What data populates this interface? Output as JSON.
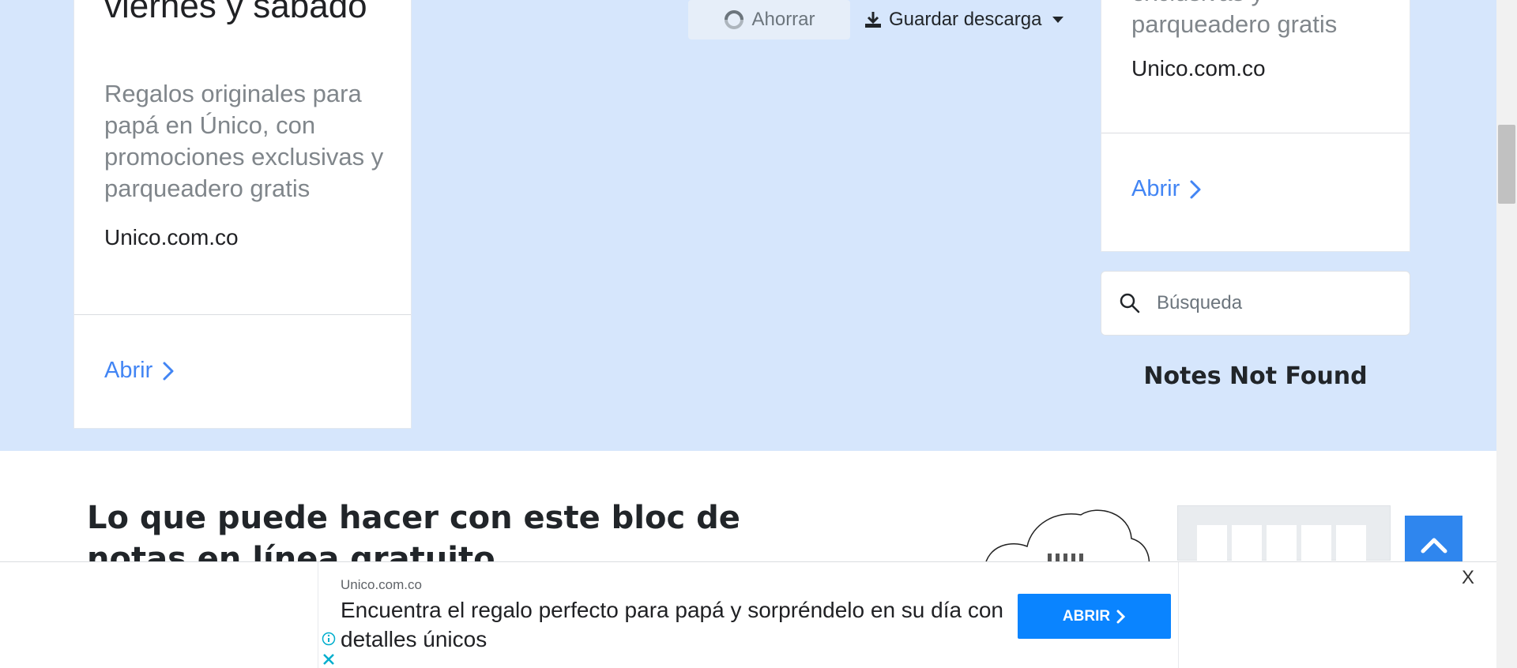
{
  "colors": {
    "page_bg": "#d6e6fc",
    "accent_blue": "#4285f4",
    "cta_blue": "#0a84ff",
    "scroll_button": "#2f86ee"
  },
  "left_ad": {
    "title": "viernes y sábado",
    "description": "Regalos originales para papá en Único, con promociones exclusivas y parqueadero gratis",
    "domain": "Unico.com.co",
    "open_label": "Abrir",
    "open_icon": "chevron-right-icon"
  },
  "right_ad": {
    "description": "exclusivas y parqueadero gratis",
    "domain": "Unico.com.co",
    "open_label": "Abrir",
    "open_icon": "chevron-right-icon"
  },
  "toolbar": {
    "save_label": "Ahorrar",
    "save_icon": "spinner-icon",
    "download_label": "Guardar descarga",
    "download_icon": "download-icon"
  },
  "search": {
    "placeholder": "Búsqueda",
    "icon": "search-icon"
  },
  "notes": {
    "empty_message": "Notes Not Found"
  },
  "features": {
    "heading": "Lo que puede hacer con este bloc de notas en línea gratuito"
  },
  "scroll_top": {
    "icon": "chevron-up-icon"
  },
  "bottom_ad": {
    "domain": "Unico.com.co",
    "text": "Encuentra el regalo perfecto para papá y sorpréndelo en su día con detalles únicos",
    "cta_label": "ABRIR",
    "close_label": "X",
    "info_icon": "info-icon",
    "close_icon": "close-icon"
  }
}
